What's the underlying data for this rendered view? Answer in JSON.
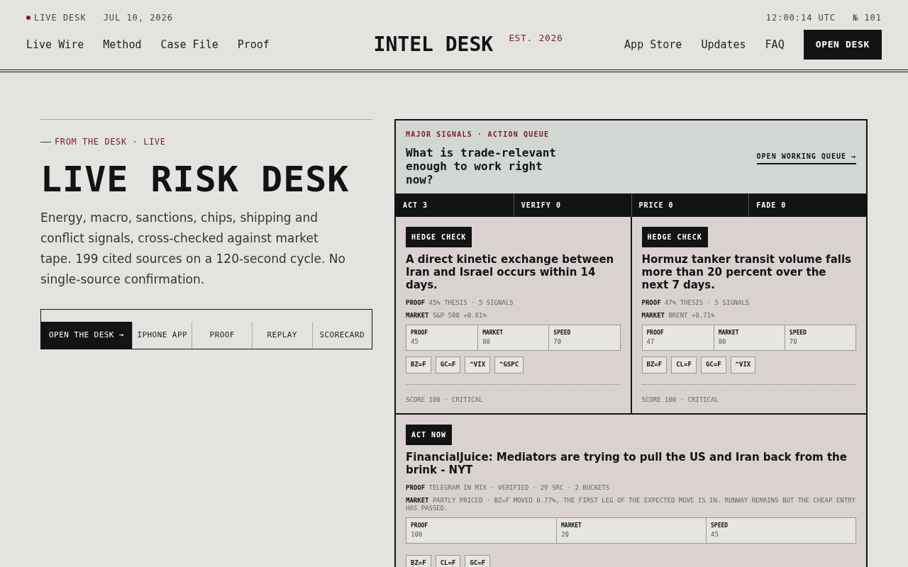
{
  "topbar": {
    "status": "LIVE DESK",
    "date": "JUL 10, 2026",
    "time": "12:00:14 UTC",
    "issue": "№ 101"
  },
  "nav": {
    "left": [
      "Live Wire",
      "Method",
      "Case File",
      "Proof"
    ],
    "brand": "INTEL DESK",
    "est": "EST. 2026",
    "right": [
      "App Store",
      "Updates",
      "FAQ"
    ],
    "cta": "OPEN DESK"
  },
  "hero": {
    "eyebrow": "FROM THE DESK · LIVE",
    "title": "LIVE RISK DESK",
    "body": "Energy, macro, sanctions, chips, shipping and conflict signals, cross-checked against market tape. 199 cited sources on a 120-second cycle. No single-source confirmation.",
    "buttons": [
      {
        "label": "OPEN THE DESK →",
        "kind": "primary"
      },
      {
        "label": "IPHONE APP",
        "kind": "plain"
      },
      {
        "label": "PROOF",
        "kind": "plain"
      },
      {
        "label": "REPLAY",
        "kind": "plain"
      },
      {
        "label": "SCORECARD",
        "kind": "plain"
      }
    ]
  },
  "queue": {
    "eyebrow": "MAJOR SIGNALS · ACTION QUEUE",
    "title": "What is trade-relevant enough to work right now?",
    "link": "OPEN WORKING QUEUE →",
    "tabs": [
      "ACT 3",
      "VERIFY 0",
      "PRICE 0",
      "FADE 0"
    ],
    "cards": [
      {
        "badge": "HEDGE CHECK",
        "title": "A direct kinetic exchange between Iran and Israel occurs within 14 days.",
        "proof_label": "PROOF",
        "proof": "45% THESIS · 5 SIGNALS",
        "market_label": "MARKET",
        "market": "S&P 500 +0.81%",
        "stats": [
          {
            "label": "PROOF",
            "value": "45"
          },
          {
            "label": "MARKET",
            "value": "80"
          },
          {
            "label": "SPEED",
            "value": "70"
          }
        ],
        "tickers": [
          "BZ=F",
          "GC=F",
          "^VIX",
          "^GSPC"
        ],
        "score": "SCORE 100 · CRITICAL"
      },
      {
        "badge": "HEDGE CHECK",
        "title": "Hormuz tanker transit volume falls more than 20 percent over the next 7 days.",
        "proof_label": "PROOF",
        "proof": "47% THESIS · 5 SIGNALS",
        "market_label": "MARKET",
        "market": "BRENT +0.71%",
        "stats": [
          {
            "label": "PROOF",
            "value": "47"
          },
          {
            "label": "MARKET",
            "value": "80"
          },
          {
            "label": "SPEED",
            "value": "70"
          }
        ],
        "tickers": [
          "BZ=F",
          "CL=F",
          "GC=F",
          "^VIX"
        ],
        "score": "SCORE 100 · CRITICAL"
      },
      {
        "badge": "ACT NOW",
        "title": "FinancialJuice: Mediators are trying to pull the US and Iran back from the brink - NYT",
        "proof_label": "PROOF",
        "proof": "TELEGRAM IN MIX · VERIFIED · 29 SRC · 2 BUCKETS",
        "market_label": "MARKET",
        "market": "PARTLY PRICED · BZ=F MOVED 0.77%, THE FIRST LEG OF THE EXPECTED MOVE IS IN. RUNWAY REMAINS BUT THE CHEAP ENTRY HAS PASSED.",
        "stats": [
          {
            "label": "PROOF",
            "value": "100"
          },
          {
            "label": "MARKET",
            "value": "20"
          },
          {
            "label": "SPEED",
            "value": "45"
          }
        ],
        "tickers": [
          "BZ=F",
          "CL=F",
          "GC=F"
        ]
      }
    ]
  }
}
